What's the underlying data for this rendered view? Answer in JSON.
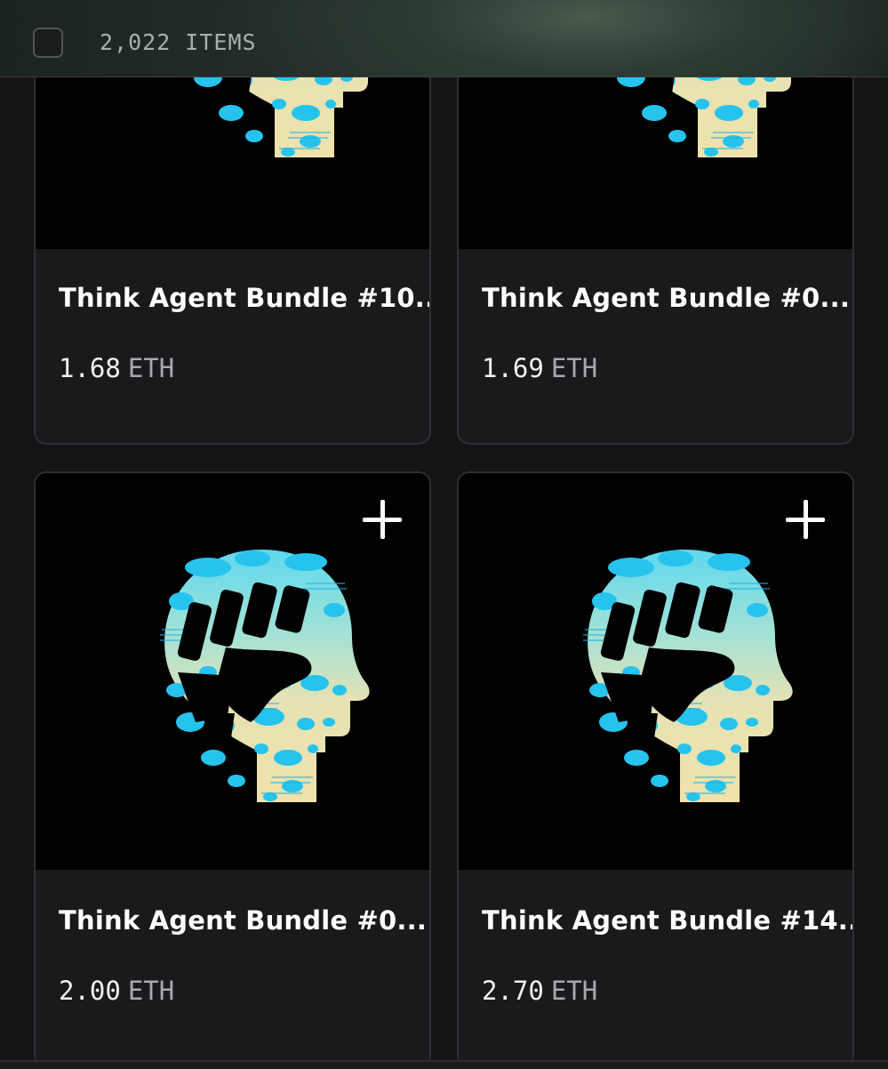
{
  "header": {
    "item_count": "2,022 ITEMS"
  },
  "listings": [
    {
      "title": "Think Agent Bundle #10...",
      "price": "1.68",
      "currency": "ETH"
    },
    {
      "title": "Think Agent Bundle #0...",
      "price": "1.69",
      "currency": "ETH"
    },
    {
      "title": "Think Agent Bundle #0...",
      "price": "2.00",
      "currency": "ETH"
    },
    {
      "title": "Think Agent Bundle #14...",
      "price": "2.70",
      "currency": "ETH"
    }
  ],
  "colors": {
    "background": "#141416",
    "card": "#1a1a1d",
    "art_blue": "#28c6ef",
    "art_cream": "#efe4b0"
  }
}
